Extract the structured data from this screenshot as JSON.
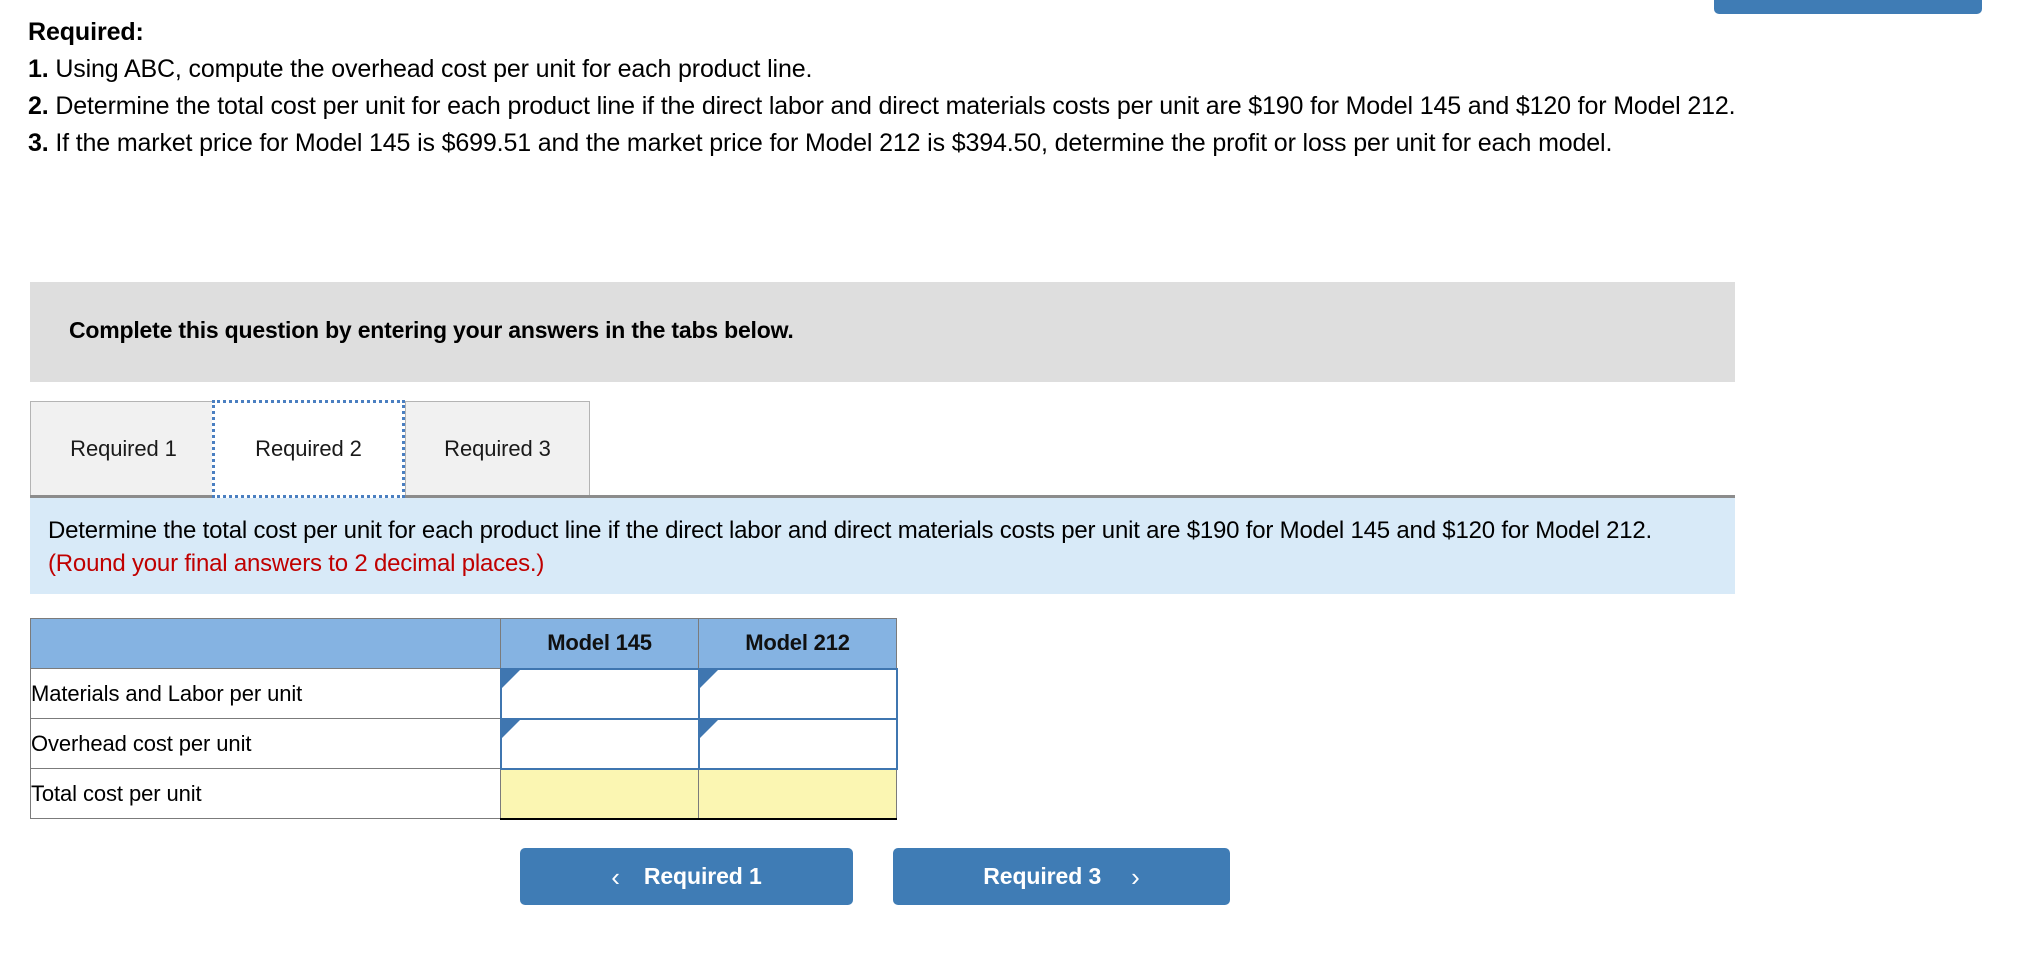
{
  "top_right": {
    "label": ""
  },
  "required": {
    "heading": "Required:",
    "items": [
      {
        "num": "1.",
        "text": " Using ABC, compute the overhead cost per unit for each product line."
      },
      {
        "num": "2.",
        "text": " Determine the total cost per unit for each product line if the direct labor and direct materials costs per unit are $190 for Model 145 and $120 for Model 212."
      },
      {
        "num": "3.",
        "text": " If the market price for Model 145 is $699.51 and the market price for Model 212 is $394.50, determine the profit or loss per unit for each model."
      }
    ]
  },
  "banner": {
    "text": "Complete this question by entering your answers in the tabs below."
  },
  "tabs": [
    {
      "label": "Required 1",
      "active": false
    },
    {
      "label": "Required 2",
      "active": true
    },
    {
      "label": "Required 3",
      "active": false
    }
  ],
  "instruction": {
    "main": "Determine the total cost per unit for each product line if the direct labor and direct materials costs per unit are $190 for Model 145 and $120 for Model 212.",
    "note": "(Round your final answers to 2 decimal places.)"
  },
  "table": {
    "columns": [
      "",
      "Model 145",
      "Model 212"
    ],
    "rows": [
      {
        "label": "Materials and Labor per unit",
        "model_145": "",
        "model_212": "",
        "type": "input"
      },
      {
        "label": "Overhead cost per unit",
        "model_145": "",
        "model_212": "",
        "type": "input"
      },
      {
        "label": "Total cost per unit",
        "model_145": "",
        "model_212": "",
        "type": "total"
      }
    ]
  },
  "nav": {
    "prev_label": "Required 1",
    "prev_icon": "chevron-left",
    "prev_glyph": "‹",
    "next_label": "Required 3",
    "next_icon": "chevron-right",
    "next_glyph": "›"
  },
  "colors": {
    "button_blue": "#3f7cb5",
    "banner_gray": "#dedede",
    "panel_blue": "#d8eaf8",
    "header_blue": "#85b3e2",
    "total_yellow": "#fbf6b2",
    "note_red": "#c00000",
    "input_border": "#3f76b0"
  }
}
